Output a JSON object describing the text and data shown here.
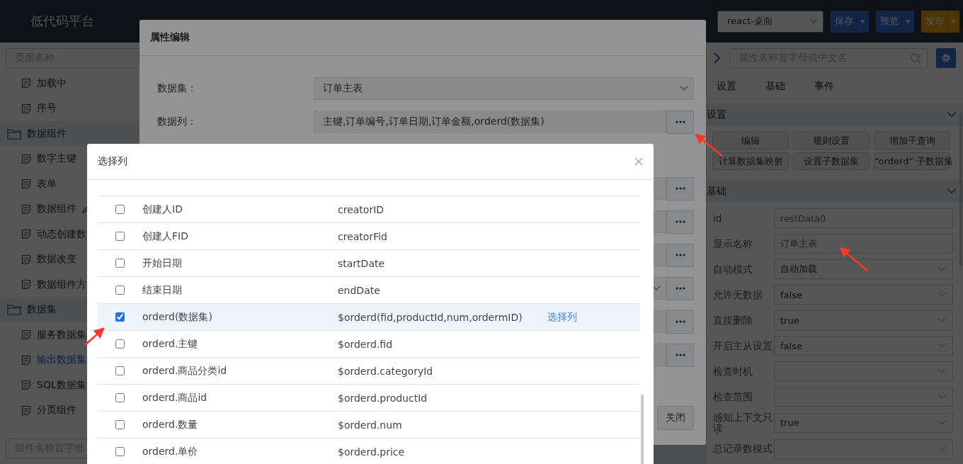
{
  "header": {
    "logo": "低代码平台",
    "project_select": "react-桌面",
    "buttons": [
      {
        "label": "保存",
        "kind": "primary"
      },
      {
        "label": "预览",
        "kind": "primary"
      },
      {
        "label": "发布",
        "kind": "warning"
      }
    ]
  },
  "sidebar": {
    "search_placeholder": "页面名称",
    "bottom_search_placeholder": "组件名称首字母",
    "items": [
      {
        "label": "加载中",
        "kind": "page",
        "selected": false
      },
      {
        "label": "序号",
        "kind": "page",
        "selected": false
      },
      {
        "label": "数据组件",
        "kind": "folder",
        "selected": false,
        "children": [
          {
            "label": "数字主键",
            "kind": "page",
            "selected": false
          },
          {
            "label": "表单",
            "kind": "page",
            "selected": false
          },
          {
            "label": "数据组件",
            "kind": "page_editable",
            "selected": false
          },
          {
            "label": "动态创建数",
            "kind": "page",
            "selected": false
          },
          {
            "label": "数据改变",
            "kind": "page",
            "selected": false
          },
          {
            "label": "数据组件方",
            "kind": "page",
            "selected": false
          }
        ]
      },
      {
        "label": "数据集",
        "kind": "folder",
        "selected": false,
        "children": [
          {
            "label": "服务数据集",
            "kind": "page",
            "selected": false
          },
          {
            "label": "输出数据集",
            "kind": "page",
            "selected": true
          },
          {
            "label": "SQL数据集",
            "kind": "page",
            "selected": false
          },
          {
            "label": "分页组件",
            "kind": "page",
            "selected": false
          }
        ]
      }
    ]
  },
  "property_panel": {
    "search_placeholder": "属性名称首字母或中文名",
    "tabs": [
      "设置",
      "基础",
      "事件"
    ],
    "sections": [
      {
        "title": "设置",
        "kind": "buttons",
        "expanded": true,
        "buttons": [
          "编辑",
          "规则设置",
          "增加子查询",
          "计算数据集映射",
          "设置子数据集",
          "“orderd” 子数据集"
        ]
      },
      {
        "title": "基础",
        "kind": "fields",
        "expanded": true,
        "fields": [
          {
            "label": "id",
            "kind": "input",
            "value": "restData0"
          },
          {
            "label": "显示名称",
            "kind": "input",
            "value": "订单主表"
          },
          {
            "label": "自动模式",
            "kind": "select",
            "value": "自动加载"
          },
          {
            "label": "允许无数据",
            "kind": "select",
            "value": "false"
          },
          {
            "label": "直接删除",
            "kind": "select",
            "value": "true"
          },
          {
            "label": "开启主从设置",
            "kind": "select",
            "value": "false"
          },
          {
            "label": "检查时机",
            "kind": "select"
          },
          {
            "label": "检查范围",
            "kind": "select"
          },
          {
            "label": "感知上下文只读",
            "kind": "select",
            "value": "true"
          },
          {
            "label": "总记录数模式",
            "kind": "select"
          }
        ]
      }
    ]
  },
  "property_dialog": {
    "title": "属性编辑",
    "close_button": "关闭",
    "rows": [
      {
        "label": "数据集：",
        "kind": "select",
        "value": "订单主表"
      },
      {
        "label": "数据列：",
        "kind": "picker",
        "value": "主键,订单编号,订单日期,订单金额,orderd(数据集)"
      },
      {
        "kind": "picker"
      },
      {
        "kind": "picker"
      },
      {
        "kind": "picker"
      },
      {
        "kind": "select_picker"
      },
      {
        "kind": "picker"
      },
      {
        "kind": "picker"
      }
    ]
  },
  "select_dialog": {
    "title": "选择列",
    "rows": [
      {
        "name": "创建人ID",
        "field": "creatorID",
        "checked": false,
        "selected": false
      },
      {
        "name": "创建人FID",
        "field": "creatorFid",
        "checked": false,
        "selected": false
      },
      {
        "name": "开始日期",
        "field": "startDate",
        "checked": false,
        "selected": false
      },
      {
        "name": "结束日期",
        "field": "endDate",
        "checked": false,
        "selected": false
      },
      {
        "name": "orderd(数据集)",
        "field": "$orderd(fid,productId,num,ordermID)",
        "action": "选择列",
        "checked": true,
        "selected": true
      },
      {
        "name": "orderd.主键",
        "field": "$orderd.fid",
        "checked": false,
        "selected": false
      },
      {
        "name": "orderd.商品分类id",
        "field": "$orderd.categoryId",
        "checked": false,
        "selected": false
      },
      {
        "name": "orderd.商品id",
        "field": "$orderd.productId",
        "checked": false,
        "selected": false
      },
      {
        "name": "orderd.数量",
        "field": "$orderd.num",
        "checked": false,
        "selected": false
      },
      {
        "name": "orderd.单价",
        "field": "$orderd.price",
        "checked": false,
        "selected": false
      }
    ]
  }
}
